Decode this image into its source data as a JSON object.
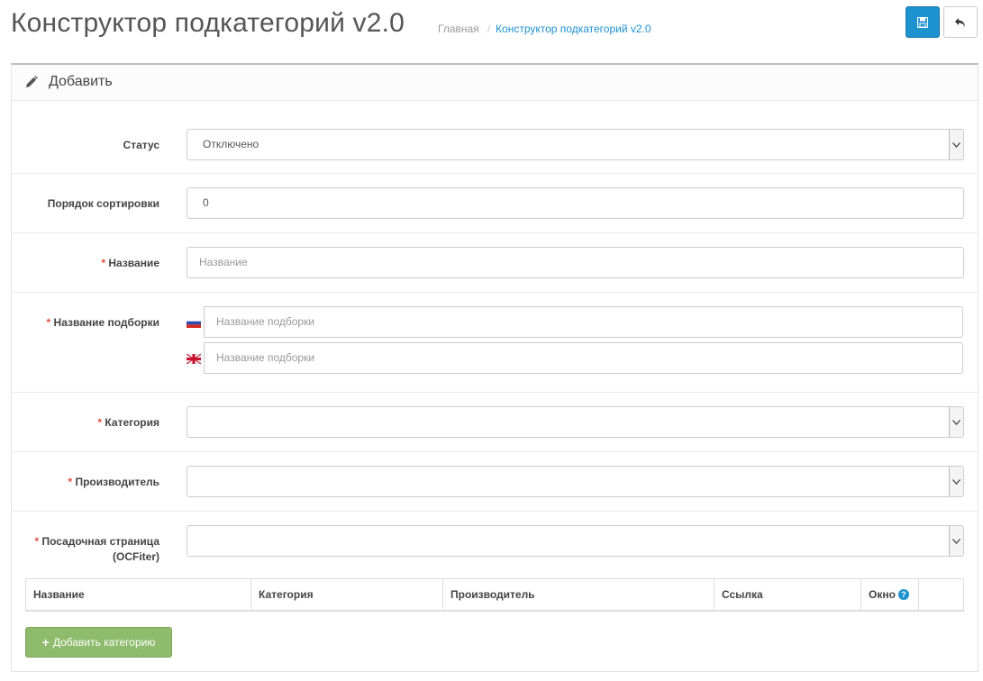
{
  "header": {
    "title": "Конструктор подкатегорий v2.0",
    "breadcrumb": {
      "home": "Главная",
      "separator": "/",
      "current": "Конструктор подкатегорий v2.0"
    },
    "save_icon": "save-icon",
    "back_icon": "reply-icon"
  },
  "panel": {
    "title": "Добавить",
    "title_icon": "pencil-icon"
  },
  "form": {
    "status": {
      "label": "Статус",
      "value": "Отключено"
    },
    "sort_order": {
      "label": "Порядок сортировки",
      "value": "0"
    },
    "name": {
      "required": "*",
      "label": "Название",
      "placeholder": "Название"
    },
    "selection_name": {
      "required": "*",
      "label": "Название подборки",
      "languages": [
        {
          "flag": "ru-flag-icon",
          "placeholder": "Название подборки"
        },
        {
          "flag": "en-flag-icon",
          "placeholder": "Название подборки"
        }
      ]
    },
    "category": {
      "required": "*",
      "label": "Категория",
      "value": ""
    },
    "manufacturer": {
      "required": "*",
      "label": "Производитель",
      "value": ""
    },
    "landing_page": {
      "required": "*",
      "label_line1": "Посадочная страница",
      "label_line2": "(OCFiter)",
      "value": ""
    }
  },
  "table": {
    "columns": [
      "Название",
      "Категория",
      "Производитель",
      "Ссылка",
      "Окно",
      ""
    ],
    "help_icon": "?"
  },
  "add_button": {
    "label": "Добавить категорию",
    "icon": "plus-icon"
  },
  "colors": {
    "primary": "#1e91cf",
    "success": "#8fbb6c",
    "required": "#e3503e"
  }
}
